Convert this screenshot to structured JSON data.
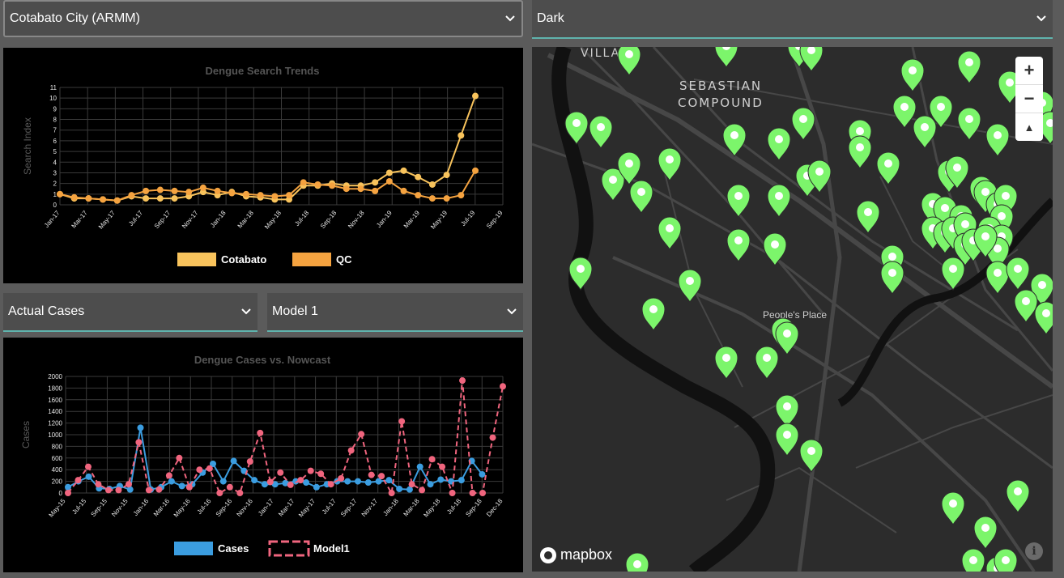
{
  "location_select": {
    "value": "Cotabato City (ARMM)"
  },
  "style_select": {
    "value": "Dark"
  },
  "cases_select": {
    "value": "Actual Cases"
  },
  "model_select": {
    "value": "Model 1"
  },
  "map": {
    "labels": {
      "line1": "SEBASTIAN",
      "line2": "COMPOUND",
      "place": "People's Place",
      "village": "VILLAGE"
    },
    "zoom_in": "+",
    "zoom_out": "−",
    "compass": "▲",
    "attribution": "mapbox",
    "info": "i",
    "colors": {
      "marker": "#7cf56b",
      "background": "#2c2c2c",
      "road": "#474747",
      "river": "#111111"
    }
  },
  "chart_data": [
    {
      "type": "line",
      "title": "Dengue Search Trends",
      "xlabel": "",
      "ylabel": "Search Index",
      "ylim": [
        0,
        11
      ],
      "yticks": [
        "0",
        "1",
        "2",
        "3",
        "4",
        "5",
        "6",
        "7",
        "8",
        "9",
        "10",
        "11"
      ],
      "xticks": [
        "Jan-17",
        "Mar-17",
        "May-17",
        "Jul-17",
        "Sep-17",
        "Nov-17",
        "Jan-18",
        "Mar-18",
        "May-18",
        "Jul-18",
        "Sep-18",
        "Nov-18",
        "Jan-19",
        "Mar-19",
        "May-19",
        "Jul-19",
        "Sep-19"
      ],
      "series": [
        {
          "name": "Cotabato",
          "color": "#f8c35c",
          "values": [
            1.0,
            0.6,
            0.6,
            0.5,
            0.4,
            0.8,
            0.6,
            0.6,
            0.6,
            0.8,
            1.2,
            0.9,
            1.2,
            0.8,
            0.7,
            0.5,
            0.5,
            1.8,
            1.8,
            2.0,
            1.8,
            1.8,
            2.1,
            3.0,
            3.2,
            2.6,
            1.9,
            2.8,
            6.5,
            10.2
          ]
        },
        {
          "name": "QC",
          "color": "#f5a340",
          "values": [
            1.0,
            0.7,
            0.6,
            0.5,
            0.4,
            0.9,
            1.3,
            1.4,
            1.3,
            1.2,
            1.6,
            1.3,
            1.1,
            1.0,
            0.9,
            0.8,
            0.9,
            2.1,
            1.9,
            1.8,
            1.5,
            1.5,
            1.3,
            2.2,
            1.3,
            0.9,
            0.6,
            0.6,
            0.9,
            3.2
          ]
        }
      ]
    },
    {
      "type": "line",
      "title": "Dengue Cases vs. Nowcast",
      "xlabel": "",
      "ylabel": "Cases",
      "ylim": [
        0,
        2000
      ],
      "yticks": [
        "0",
        "200",
        "400",
        "600",
        "800",
        "1000",
        "1200",
        "1400",
        "1600",
        "1800",
        "2000"
      ],
      "xticks": [
        "May-15",
        "Jul-15",
        "Sep-15",
        "Nov-15",
        "Jan-16",
        "Mar-16",
        "May-16",
        "Jul-16",
        "Sep-16",
        "Nov-16",
        "Jan-17",
        "Mar-17",
        "May-17",
        "Jul-17",
        "Sep-17",
        "Nov-17",
        "Jan-18",
        "Mar-18",
        "May-18",
        "Jul-18",
        "Sep-18",
        "Dec-18"
      ],
      "series": [
        {
          "name": "Cases",
          "color": "#3b9de0",
          "values": [
            100,
            200,
            280,
            80,
            70,
            120,
            60,
            1120,
            60,
            100,
            200,
            120,
            150,
            350,
            500,
            200,
            550,
            380,
            220,
            150,
            150,
            170,
            200,
            180,
            100,
            150,
            200,
            200,
            200,
            180,
            200,
            220,
            70,
            60,
            450,
            150,
            230,
            200,
            220,
            550,
            320,
            null,
            null
          ]
        },
        {
          "name": "Model1",
          "color": "#f0657e",
          "values": [
            0,
            220,
            450,
            150,
            50,
            50,
            150,
            870,
            50,
            60,
            300,
            600,
            100,
            400,
            420,
            0,
            100,
            0,
            540,
            1030,
            190,
            350,
            140,
            220,
            380,
            330,
            150,
            250,
            730,
            1010,
            310,
            290,
            0,
            1230,
            150,
            50,
            580,
            450,
            0,
            1930,
            0,
            0,
            950,
            1830
          ]
        }
      ]
    }
  ]
}
